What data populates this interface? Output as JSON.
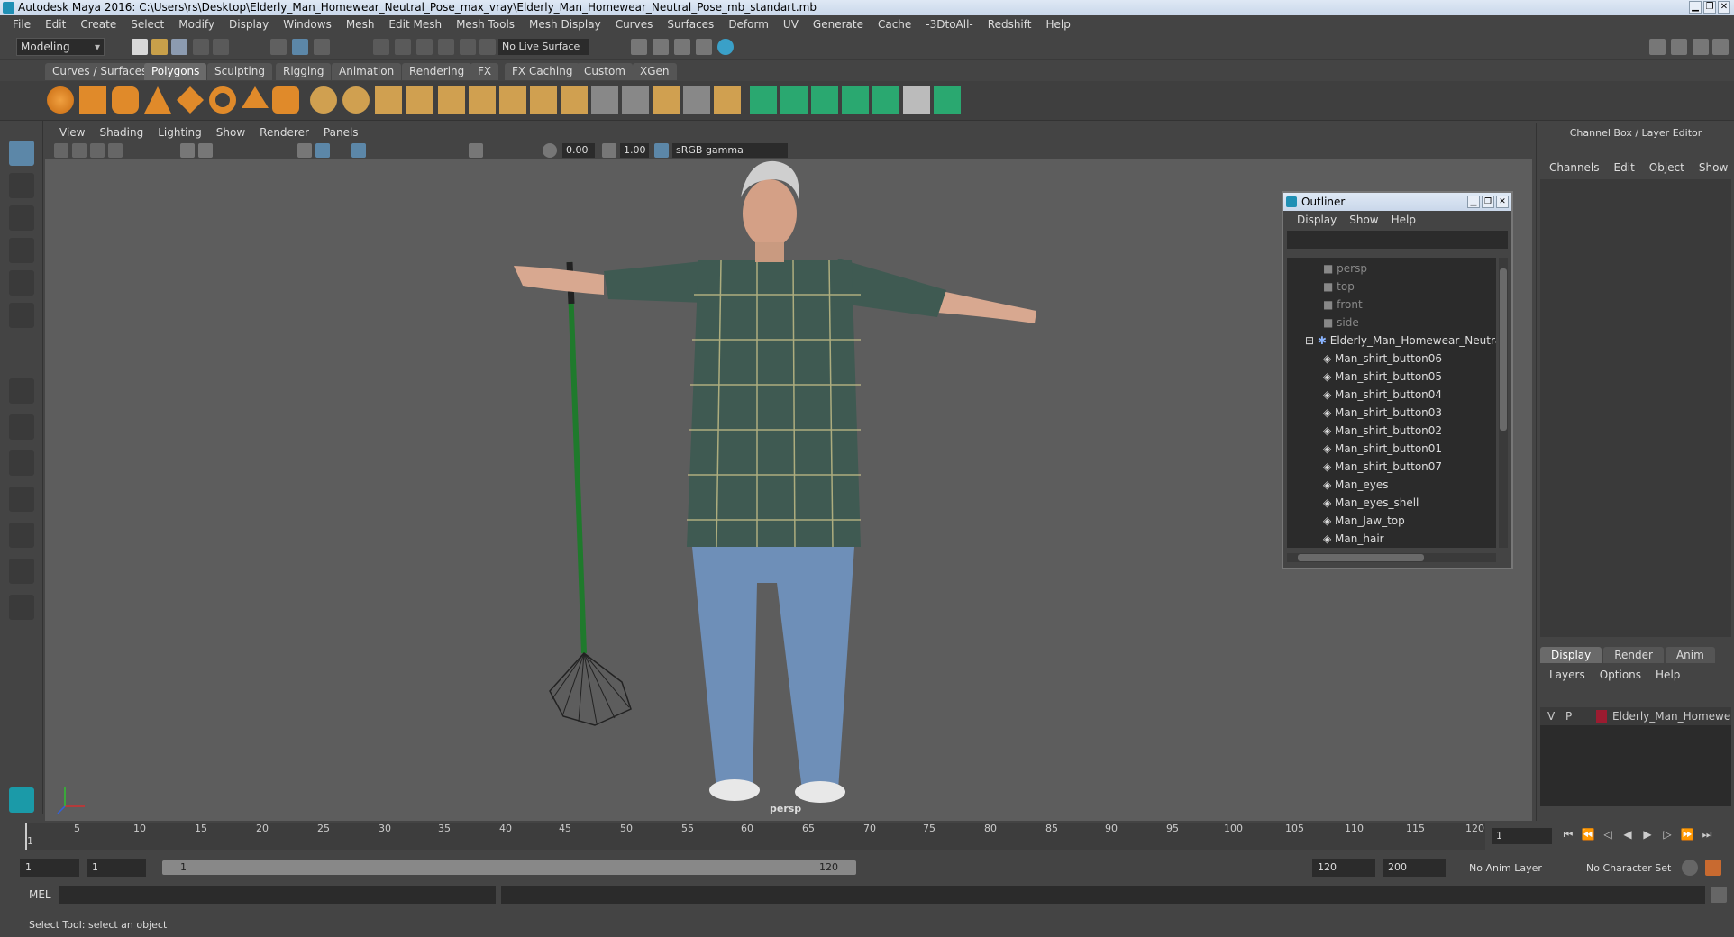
{
  "window": {
    "title": "Autodesk Maya 2016: C:\\Users\\rs\\Desktop\\Elderly_Man_Homewear_Neutral_Pose_max_vray\\Elderly_Man_Homewear_Neutral_Pose_mb_standart.mb",
    "min": "▁",
    "max": "❐",
    "close": "✕"
  },
  "menubar": [
    "File",
    "Edit",
    "Create",
    "Select",
    "Modify",
    "Display",
    "Windows",
    "Mesh",
    "Edit Mesh",
    "Mesh Tools",
    "Mesh Display",
    "Curves",
    "Surfaces",
    "Deform",
    "UV",
    "Generate",
    "Cache",
    "-3DtoAll-",
    "Redshift",
    "Help"
  ],
  "status": {
    "mode": "Modeling",
    "live_surface": "No Live Surface"
  },
  "shelf_tabs": [
    "Curves / Surfaces",
    "Polygons",
    "Sculpting",
    "Rigging",
    "Animation",
    "Rendering",
    "FX",
    "FX Caching",
    "Custom",
    "XGen"
  ],
  "shelf_active": "Polygons",
  "viewport_menu": [
    "View",
    "Shading",
    "Lighting",
    "Show",
    "Renderer",
    "Panels"
  ],
  "viewport_toolbar": {
    "exposure": "0.00",
    "gamma": "1.00",
    "color_space": "sRGB gamma"
  },
  "viewport": {
    "camera": "persp"
  },
  "outliner": {
    "title": "Outliner",
    "menu": [
      "Display",
      "Show",
      "Help"
    ],
    "items": [
      {
        "label": "persp",
        "kind": "camera"
      },
      {
        "label": "top",
        "kind": "camera"
      },
      {
        "label": "front",
        "kind": "camera"
      },
      {
        "label": "side",
        "kind": "camera"
      },
      {
        "label": "Elderly_Man_Homewear_Neutral_",
        "kind": "group"
      },
      {
        "label": "Man_shirt_button06",
        "kind": "mesh"
      },
      {
        "label": "Man_shirt_button05",
        "kind": "mesh"
      },
      {
        "label": "Man_shirt_button04",
        "kind": "mesh"
      },
      {
        "label": "Man_shirt_button03",
        "kind": "mesh"
      },
      {
        "label": "Man_shirt_button02",
        "kind": "mesh"
      },
      {
        "label": "Man_shirt_button01",
        "kind": "mesh"
      },
      {
        "label": "Man_shirt_button07",
        "kind": "mesh"
      },
      {
        "label": "Man_eyes",
        "kind": "mesh"
      },
      {
        "label": "Man_eyes_shell",
        "kind": "mesh"
      },
      {
        "label": "Man_Jaw_top",
        "kind": "mesh"
      },
      {
        "label": "Man_hair",
        "kind": "mesh"
      }
    ]
  },
  "right_panel": {
    "title": "Channel Box / Layer Editor",
    "menu": [
      "Channels",
      "Edit",
      "Object",
      "Show"
    ],
    "tabs": [
      "Display",
      "Render",
      "Anim"
    ],
    "active_tab": "Display",
    "layer_menu": [
      "Layers",
      "Options",
      "Help"
    ],
    "layer": {
      "v": "V",
      "p": "P",
      "name": "Elderly_Man_Homewear",
      "color": "#9b1b30"
    }
  },
  "timeline": {
    "ticks": [
      "5",
      "10",
      "15",
      "20",
      "25",
      "30",
      "35",
      "40",
      "45",
      "50",
      "55",
      "60",
      "65",
      "70",
      "75",
      "80",
      "85",
      "90",
      "95",
      "100",
      "105",
      "110",
      "115",
      "120"
    ],
    "current_frame": "1",
    "start_marker": "1"
  },
  "range": {
    "start": "1",
    "anim_start": "1",
    "slider_start": "1",
    "slider_end": "120",
    "end": "120",
    "anim_end": "200",
    "anim_layer": "No Anim Layer",
    "character_set": "No Character Set"
  },
  "cmdline": {
    "label": "MEL"
  },
  "help_line": "Select Tool: select an object",
  "colors": {
    "accent": "#5c87a8",
    "viewport_bg": "#5d5d5d"
  }
}
